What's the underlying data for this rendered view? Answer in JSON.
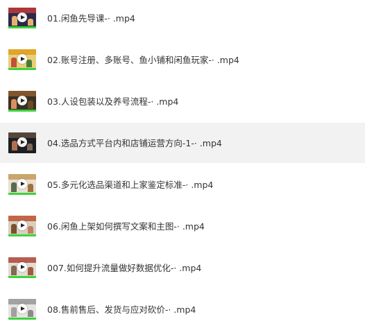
{
  "files": [
    {
      "name": "01.闲鱼先导课-· .mp4",
      "theme": {
        "bg": "#2c2a4a",
        "band": "#b83a3a",
        "fig": "#e8b070"
      }
    },
    {
      "name": "02.账号注册、多账号、鱼小铺和闲鱼玩家-·  .mp4",
      "theme": {
        "bg": "#e8d07a",
        "band": "#e0a020",
        "fig": "#c0503a"
      }
    },
    {
      "name": "03.人设包装以及养号流程-· .mp4",
      "theme": {
        "bg": "#3a2f24",
        "band": "#8a5a30",
        "fig": "#d89060"
      }
    },
    {
      "name": "04.选品方式平台内和店铺运营方向-1-·  .mp4",
      "theme": {
        "bg": "#1e1e22",
        "band": "#5a4a40",
        "fig": "#b07050"
      }
    },
    {
      "name": "05.多元化选品渠道和上家鉴定标准-· .mp4",
      "theme": {
        "bg": "#e8e0d2",
        "band": "#c8a060",
        "fig": "#5a6a50"
      }
    },
    {
      "name": "06.闲鱼上架如何撰写文案和主图-· .mp4",
      "theme": {
        "bg": "#d8cfc2",
        "band": "#c05a3a",
        "fig": "#7a5030"
      }
    },
    {
      "name": "007.如何提升流量做好数据优化-· .mp4",
      "theme": {
        "bg": "#e2ddd4",
        "band": "#b05040",
        "fig": "#806a50"
      }
    },
    {
      "name": "08.售前售后、发货与应对砍价-· .mp4",
      "theme": {
        "bg": "#e6e4e0",
        "band": "#9a9a9a",
        "fig": "#a0a0a0"
      }
    }
  ],
  "selected_index": 3
}
